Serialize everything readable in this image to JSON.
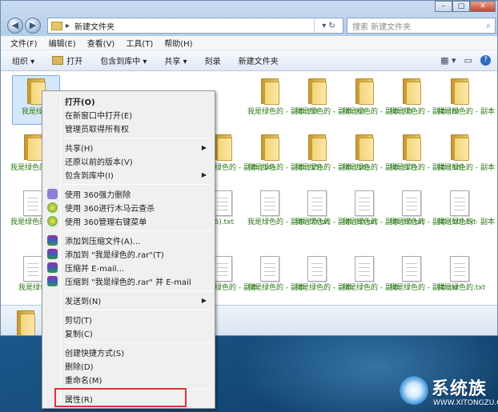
{
  "window": {
    "path": "新建文件夹",
    "nav_back": "◀",
    "nav_fwd": "▶",
    "refresh": "▾ ↻",
    "search_placeholder": "搜索 新建文件夹",
    "minimize": "–",
    "maximize": "□",
    "close": "✕"
  },
  "menubar": [
    "文件(F)",
    "编辑(E)",
    "查看(V)",
    "工具(T)",
    "帮助(H)"
  ],
  "toolbar": {
    "organize": "组织 ▾",
    "open": "打开",
    "include": "包含到库中 ▾",
    "share": "共享 ▾",
    "burn": "刻录",
    "new_folder": "新建文件夹"
  },
  "files": {
    "row1": [
      "我是绿色",
      "我是绿色的 - 副本 (5)",
      "我是绿色的 - 副本 (6)",
      "我是绿色的 - 副本 (7)",
      "我是绿色的 - 副本 (8)",
      "我是绿色的 - 副本 (9)"
    ],
    "row2": [
      "我是绿色的 - 副本",
      "我是绿色的 - 副本 (14)",
      "我是绿色的 - 副本 (15)",
      "我是绿色的 - 副本 (16)",
      "我是绿色的 - 副本 (17)",
      "我是绿色的 - 副本 (18)",
      "我是绿色的 - 副本 (19)"
    ],
    "row3": [
      "我是绿色的 - 副本 (2).txt",
      "(6).txt",
      "我是绿色的 - 副本 (7).txt",
      "我是绿色的 - 副本 (8).txt",
      "我是绿色的 - 副本 (9).txt",
      "我是绿色的 - 副本 (10).txt",
      "我是绿色的 - 副本 (11).txt"
    ],
    "row4": [
      "我是绿色",
      "我是绿色的 - 副本",
      "我是绿色的 - 副本",
      "我是绿色的 - 副本",
      "我是绿色的 - 副本",
      "我是绿色的 - 副本.txt",
      "我是绿色的.txt"
    ]
  },
  "context_menu": {
    "open": "打开(O)",
    "open_new": "在新窗口中打开(E)",
    "admin": "管理员取得所有权",
    "share": "共享(H)",
    "restore": "还原以前的版本(V)",
    "include": "包含到库中(I)",
    "del360": "使用 360强力删除",
    "scan360": "使用 360进行木马云查杀",
    "manage360": "使用 360管理右键菜单",
    "addzip": "添加到压缩文件(A)...",
    "addrar": "添加到 \"我是绿色的.rar\"(T)",
    "zipmail": "压缩并 E-mail...",
    "rarmail": "压缩到 \"我是绿色的.rar\" 并 E-mail",
    "sendto": "发送到(N)",
    "cut": "剪切(T)",
    "copy": "复制(C)",
    "shortcut": "创建快捷方式(S)",
    "delete": "删除(D)",
    "rename": "重命名(M)",
    "properties": "属性(R)",
    "arrow": "▶"
  },
  "watermark": {
    "name": "系统族",
    "url": "WWW.XITONGZU.COM"
  },
  "colors": {
    "label_green": "#2d7a18",
    "highlight_red": "#e0323c"
  }
}
